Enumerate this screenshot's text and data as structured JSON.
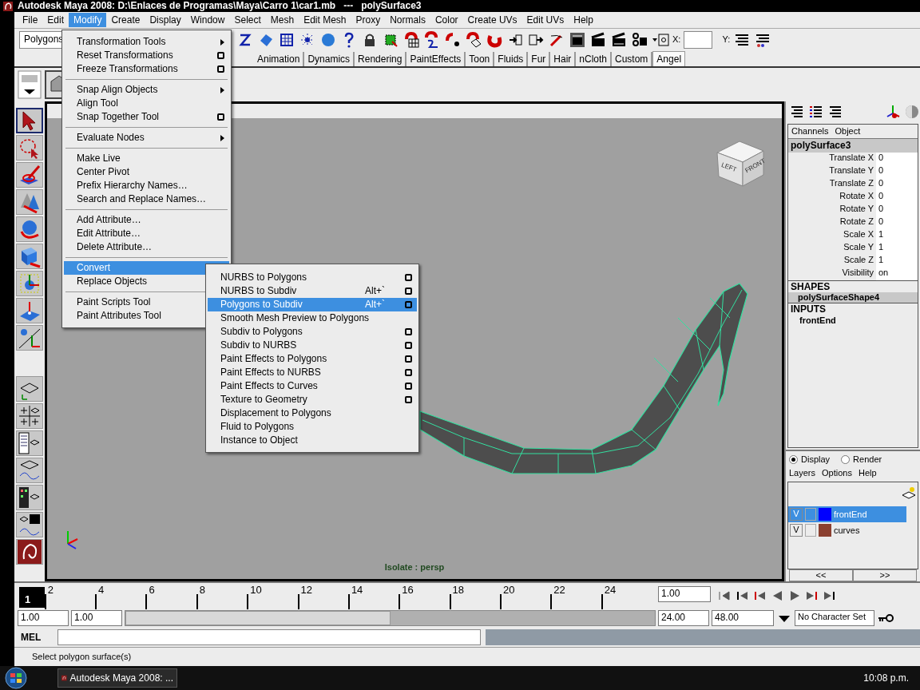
{
  "window": {
    "title": "Autodesk Maya 2008: D:\\Enlaces de Programas\\Maya\\Carro 1\\car1.mb   ---   polySurface3"
  },
  "menu_bar": [
    {
      "label": "File",
      "selected": false
    },
    {
      "label": "Edit",
      "selected": false
    },
    {
      "label": "Modify",
      "selected": true
    },
    {
      "label": "Create",
      "selected": false
    },
    {
      "label": "Display",
      "selected": false
    },
    {
      "label": "Window",
      "selected": false
    },
    {
      "label": "Select",
      "selected": false
    },
    {
      "label": "Mesh",
      "selected": false
    },
    {
      "label": "Edit Mesh",
      "selected": false
    },
    {
      "label": "Proxy",
      "selected": false
    },
    {
      "label": "Normals",
      "selected": false
    },
    {
      "label": "Color",
      "selected": false
    },
    {
      "label": "Create UVs",
      "selected": false
    },
    {
      "label": "Edit UVs",
      "selected": false
    },
    {
      "label": "Help",
      "selected": false
    }
  ],
  "status_line": {
    "menu_set": "Polygons",
    "x_label": "X:",
    "y_label": "Y:"
  },
  "shelf_tabs": [
    {
      "label": "Animation",
      "selected": false
    },
    {
      "label": "Dynamics",
      "selected": false
    },
    {
      "label": "Rendering",
      "selected": false
    },
    {
      "label": "PaintEffects",
      "selected": false
    },
    {
      "label": "Toon",
      "selected": false
    },
    {
      "label": "Fluids",
      "selected": false
    },
    {
      "label": "Fur",
      "selected": false
    },
    {
      "label": "Hair",
      "selected": false
    },
    {
      "label": "nCloth",
      "selected": false
    },
    {
      "label": "Custom",
      "selected": false
    },
    {
      "label": "Angel",
      "selected": true
    }
  ],
  "modify_menu": {
    "groups": [
      [
        {
          "label": "Transformation Tools",
          "kind": "submenu",
          "selected": false
        },
        {
          "label": "Reset Transformations",
          "kind": "option",
          "selected": false
        },
        {
          "label": "Freeze Transformations",
          "kind": "option",
          "selected": false
        }
      ],
      [
        {
          "label": "Snap Align Objects",
          "kind": "submenu",
          "selected": false
        },
        {
          "label": "Align Tool",
          "kind": "plain",
          "selected": false
        },
        {
          "label": "Snap Together Tool",
          "kind": "option",
          "selected": false
        }
      ],
      [
        {
          "label": "Evaluate Nodes",
          "kind": "submenu",
          "selected": false
        }
      ],
      [
        {
          "label": "Make Live",
          "kind": "plain",
          "selected": false
        },
        {
          "label": "Center Pivot",
          "kind": "plain",
          "selected": false
        },
        {
          "label": "Prefix Hierarchy Names…",
          "kind": "plain",
          "selected": false
        },
        {
          "label": "Search and Replace Names…",
          "kind": "plain",
          "selected": false
        }
      ],
      [
        {
          "label": "Add Attribute…",
          "kind": "plain",
          "selected": false
        },
        {
          "label": "Edit Attribute…",
          "kind": "plain",
          "selected": false
        },
        {
          "label": "Delete Attribute…",
          "kind": "plain",
          "selected": false
        }
      ],
      [
        {
          "label": "Convert",
          "kind": "submenu",
          "selected": true
        },
        {
          "label": "Replace Objects",
          "kind": "plain",
          "selected": false
        }
      ],
      [
        {
          "label": "Paint Scripts Tool",
          "kind": "plain",
          "selected": false
        },
        {
          "label": "Paint Attributes Tool",
          "kind": "plain",
          "selected": false
        }
      ]
    ]
  },
  "convert_submenu": {
    "items": [
      {
        "label": "NURBS to Polygons",
        "option_box": true,
        "selected": false
      },
      {
        "label": "NURBS to Subdiv",
        "shortcut": "Alt+`",
        "option_box": true,
        "selected": false
      },
      {
        "label": "Polygons to Subdiv",
        "shortcut": "Alt+`",
        "option_box": true,
        "selected": true
      },
      {
        "label": "Smooth Mesh Preview to Polygons",
        "option_box": false,
        "selected": false
      },
      {
        "label": "Subdiv to Polygons",
        "option_box": true,
        "selected": false
      },
      {
        "label": "Subdiv to NURBS",
        "option_box": true,
        "selected": false
      },
      {
        "label": "Paint Effects to Polygons",
        "option_box": true,
        "selected": false
      },
      {
        "label": "Paint Effects to NURBS",
        "option_box": true,
        "selected": false
      },
      {
        "label": "Paint Effects to Curves",
        "option_box": true,
        "selected": false
      },
      {
        "label": "Texture to Geometry",
        "option_box": true,
        "selected": false
      },
      {
        "label": "Displacement to Polygons",
        "option_box": false,
        "selected": false
      },
      {
        "label": "Fluid to Polygons",
        "option_box": false,
        "selected": false
      },
      {
        "label": "Instance to Object",
        "option_box": false,
        "selected": false
      }
    ]
  },
  "viewport": {
    "isolate_label": "Isolate : persp",
    "view_cube": {
      "left": "LEFT",
      "front": "FRONT"
    }
  },
  "channel_box": {
    "tabs": [
      "Channels",
      "Object"
    ],
    "node": "polySurface3",
    "attributes": [
      {
        "name": "Translate X",
        "value": "0"
      },
      {
        "name": "Translate Y",
        "value": "0"
      },
      {
        "name": "Translate Z",
        "value": "0"
      },
      {
        "name": "Rotate X",
        "value": "0"
      },
      {
        "name": "Rotate Y",
        "value": "0"
      },
      {
        "name": "Rotate Z",
        "value": "0"
      },
      {
        "name": "Scale X",
        "value": "1"
      },
      {
        "name": "Scale Y",
        "value": "1"
      },
      {
        "name": "Scale Z",
        "value": "1"
      },
      {
        "name": "Visibility",
        "value": "on"
      }
    ],
    "shapes_heading": "SHAPES",
    "shape": "polySurfaceShape4",
    "inputs_heading": "INPUTS",
    "input": "frontEnd"
  },
  "layer_editor": {
    "modes": [
      {
        "label": "Display",
        "selected": true
      },
      {
        "label": "Render",
        "selected": false
      }
    ],
    "menu": [
      "Layers",
      "Options",
      "Help"
    ],
    "layers": [
      {
        "visibility": "V",
        "name": "frontEnd",
        "color": "#0000ff",
        "selected": true
      },
      {
        "visibility": "V",
        "name": "curves",
        "color": "#8b4030",
        "selected": false
      }
    ],
    "scroll_left": "<<",
    "scroll_right": ">>"
  },
  "timeline": {
    "current": "1",
    "level": 0,
    "ticks": [
      "2",
      "4",
      "6",
      "8",
      "10",
      "12",
      "14",
      "16",
      "18",
      "20",
      "22",
      "24"
    ],
    "current_time": "1.00"
  },
  "range": {
    "level": 0.5,
    "start": "1.00",
    "playback_start": "1.00",
    "playback_end": "24.00",
    "end": "48.00",
    "character_set": "No Character Set"
  },
  "command_line": {
    "label": "MEL"
  },
  "help_line": "Select polygon surface(s)",
  "taskbar": {
    "task": "Autodesk Maya 2008: ...",
    "clock": "10:08 p.m."
  }
}
